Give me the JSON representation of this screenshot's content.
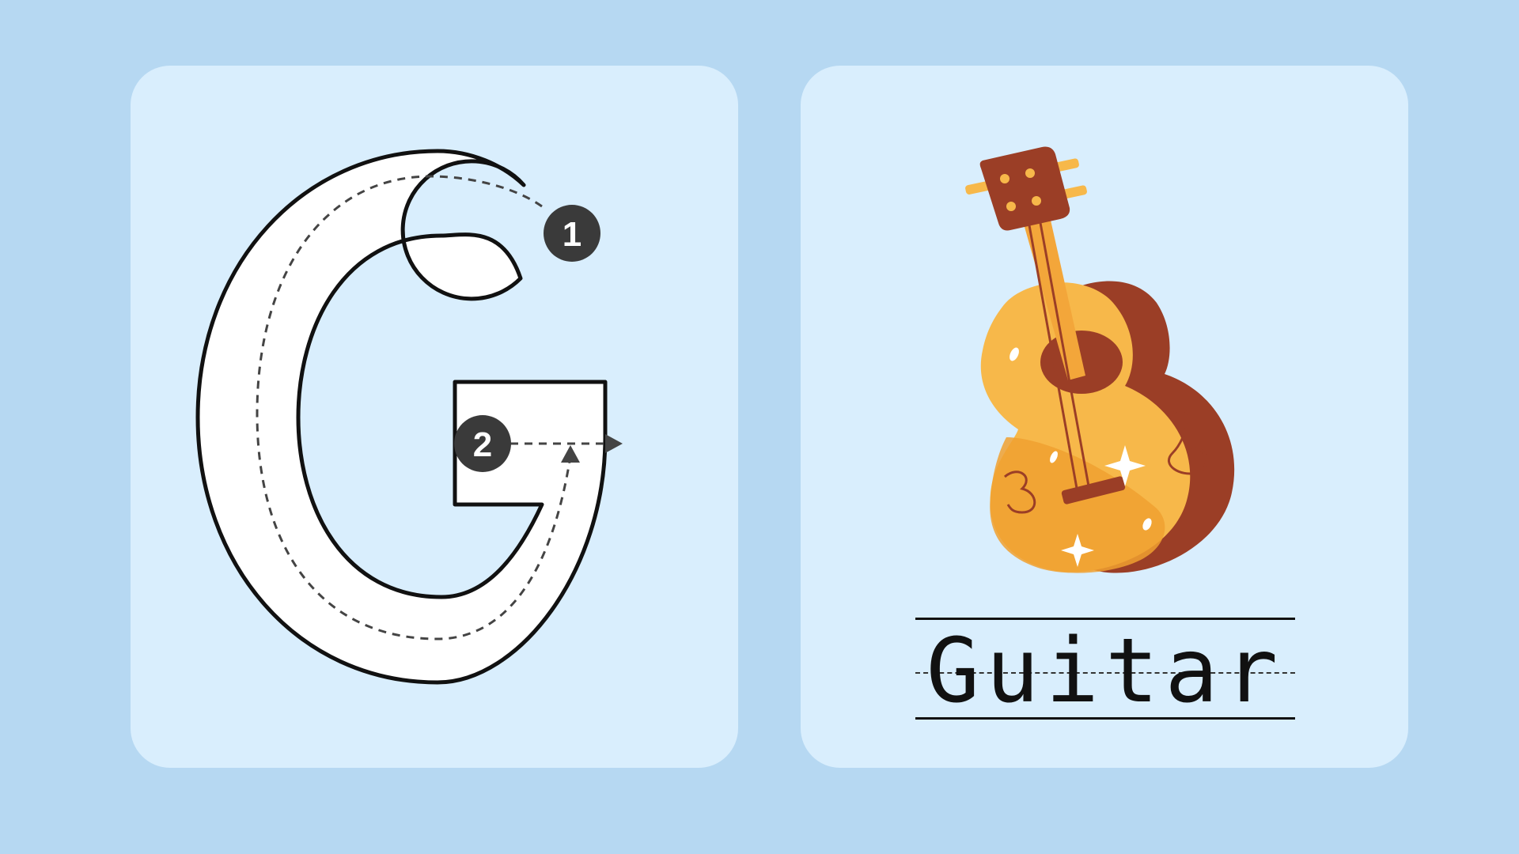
{
  "letter_card": {
    "letter": "G",
    "stroke_steps": [
      "1",
      "2"
    ]
  },
  "word_card": {
    "word": "Guitar",
    "picture": "guitar-illustration"
  },
  "colors": {
    "background": "#b6d8f2",
    "card": "#d9eefd",
    "letter_fill": "#ffffff",
    "outline": "#111111",
    "step_badge": "#3a3a3a",
    "guitar_body": "#f7b84a",
    "guitar_accent": "#f0a030",
    "guitar_dark": "#9b3e26"
  }
}
